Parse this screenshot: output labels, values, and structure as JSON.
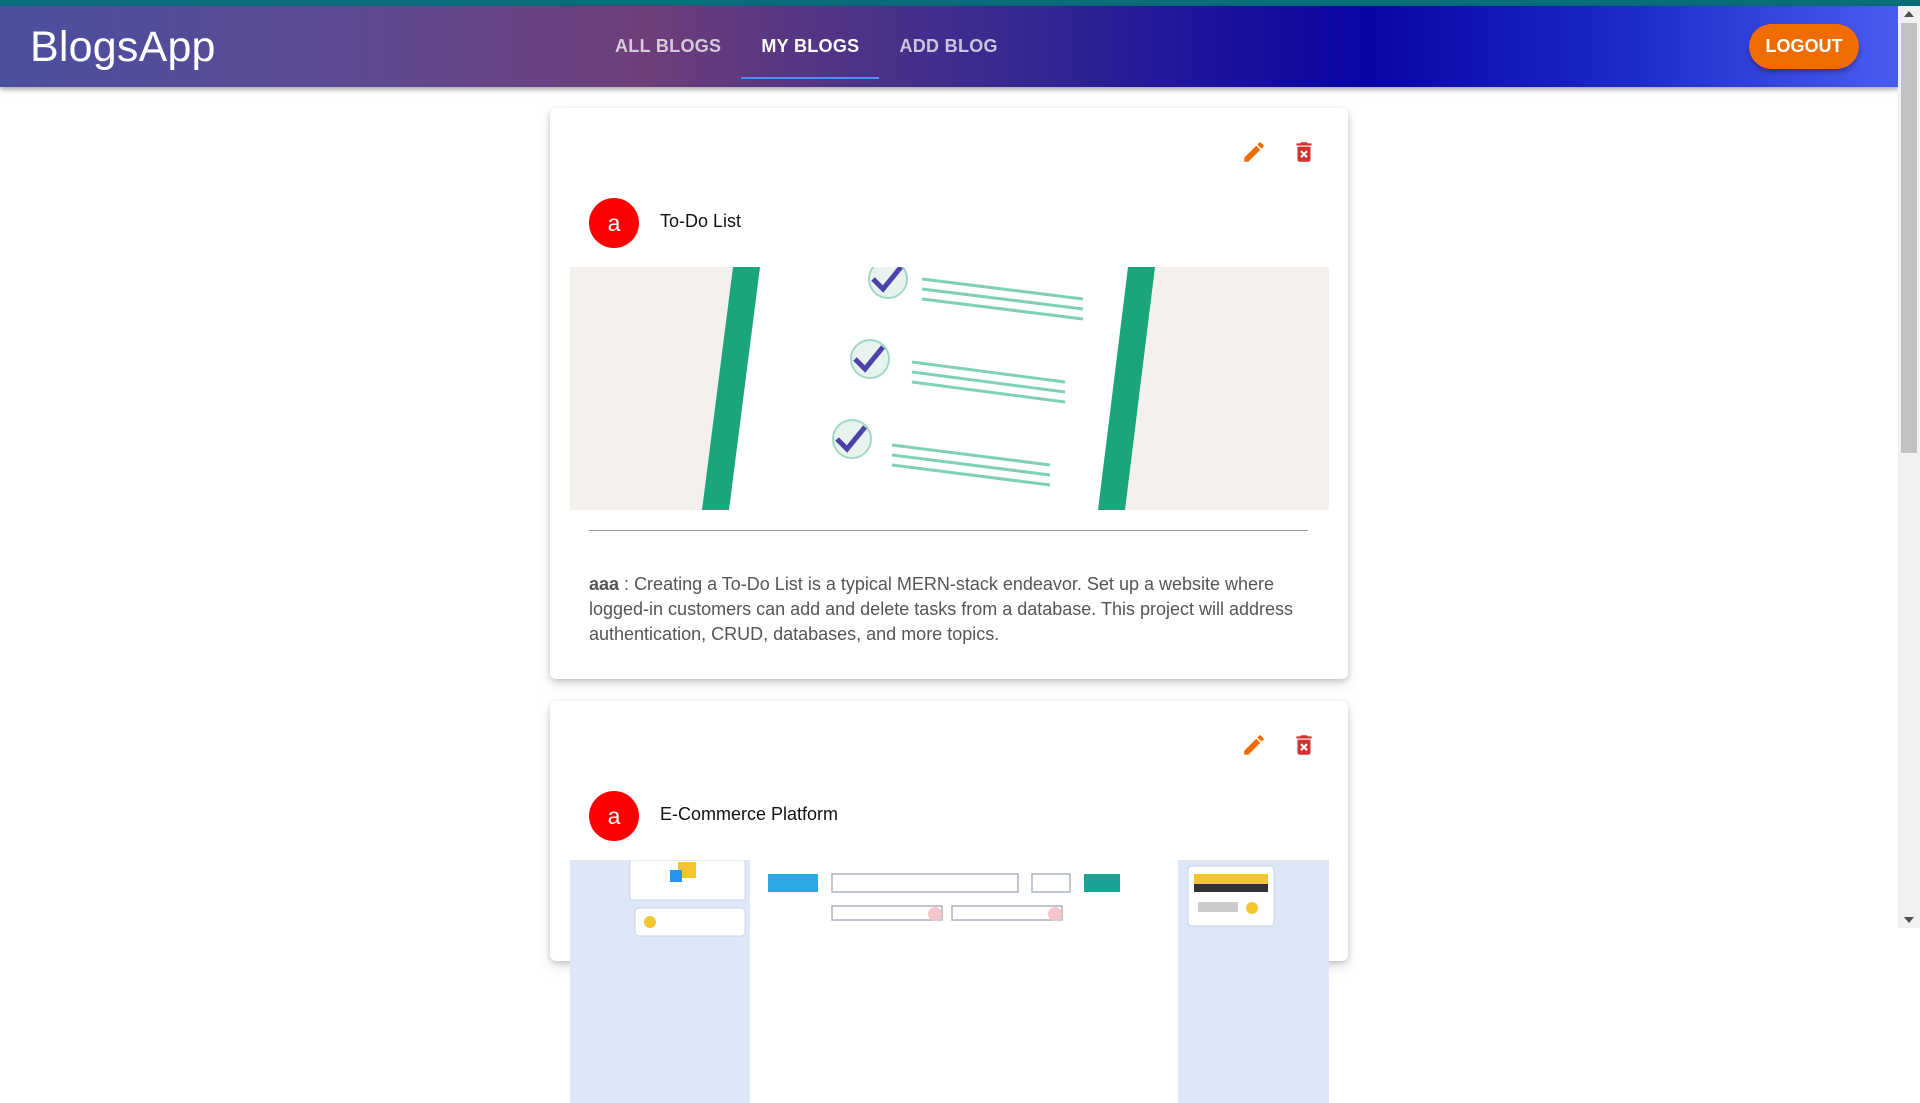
{
  "app": {
    "brand": "BlogsApp"
  },
  "nav": {
    "tabs": [
      {
        "label": "ALL BLOGS",
        "active": false
      },
      {
        "label": "MY BLOGS",
        "active": true
      },
      {
        "label": "ADD BLOG",
        "active": false
      }
    ],
    "logout_label": "LOGOUT"
  },
  "colors": {
    "accent": "#f06c00",
    "delete": "#d32f2f",
    "avatar": "#ff0000",
    "tab_indicator": "#4f8df5"
  },
  "blogs": [
    {
      "avatar_letter": "a",
      "title": "To-Do List",
      "image_icon": "todo-checklist-image",
      "author": "aaa",
      "separator": " : ",
      "description": "Creating a To-Do List is a typical MERN-stack endeavor. Set up a website where logged-in customers can add and delete tasks from a database. This project will address authentication, CRUD, databases, and more topics."
    },
    {
      "avatar_letter": "a",
      "title": "E-Commerce Platform",
      "image_icon": "ecommerce-wireframe-image"
    }
  ]
}
